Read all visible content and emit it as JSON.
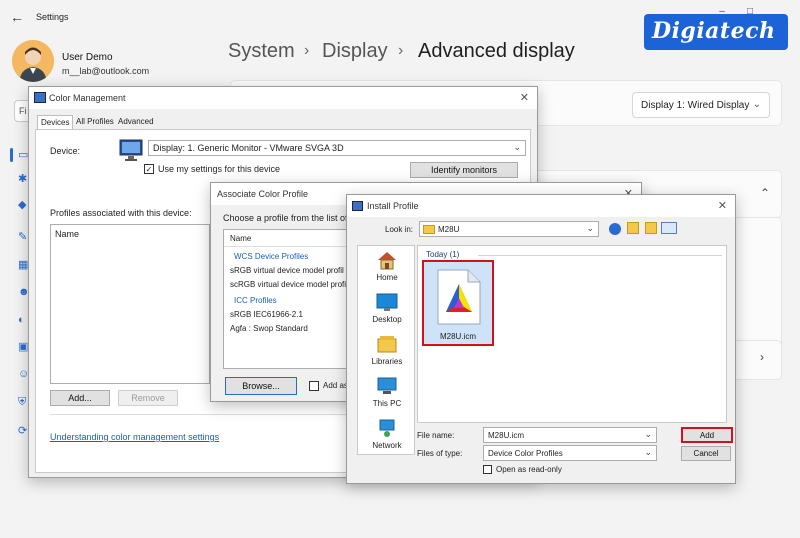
{
  "settings": {
    "title": "Settings",
    "user": {
      "name": "User Demo",
      "email": "m__lab@outlook.com"
    },
    "breadcrumb": [
      "System",
      "Display",
      "Advanced display"
    ],
    "search_placeholder": "Fi",
    "display_select": "Display 1: Wired Display"
  },
  "watermark": {
    "text": "Digiatech"
  },
  "color_management": {
    "title": "Color Management",
    "tabs": [
      "Devices",
      "All Profiles",
      "Advanced"
    ],
    "device_label": "Device:",
    "device_value": "Display: 1. Generic Monitor - VMware SVGA 3D",
    "use_my_settings": "Use my settings for this device",
    "identify_button": "Identify monitors",
    "profiles_label": "Profiles associated with this device:",
    "list_header": "Name",
    "add_button": "Add...",
    "remove_button": "Remove",
    "link": "Understanding color management settings"
  },
  "associate": {
    "title": "Associate Color Profile",
    "prompt": "Choose a profile from the list of p",
    "list_header": "Name",
    "groups": [
      {
        "label": "WCS Device Profiles",
        "items": [
          "sRGB virtual device model profil",
          "scRGB virtual device model profi"
        ]
      },
      {
        "label": "ICC Profiles",
        "items": [
          "sRGB IEC61966-2.1",
          "Agfa : Swop Standard"
        ]
      }
    ],
    "browse_button": "Browse...",
    "add_as_label": "Add as"
  },
  "install": {
    "title": "Install Profile",
    "look_in_label": "Look in:",
    "look_in_value": "M28U",
    "places": [
      "Home",
      "Desktop",
      "Libraries",
      "This PC",
      "Network"
    ],
    "group_label": "Today (1)",
    "file_name_display": "M28U.icm",
    "file_name_label": "File name:",
    "file_name_value": "M28U.icm",
    "files_type_label": "Files of type:",
    "files_type_value": "Device Color Profiles",
    "open_readonly": "Open as read-only",
    "add_button": "Add",
    "cancel_button": "Cancel"
  },
  "colors": {
    "accent": "#2a6bd1",
    "highlight": "#d0121c"
  }
}
